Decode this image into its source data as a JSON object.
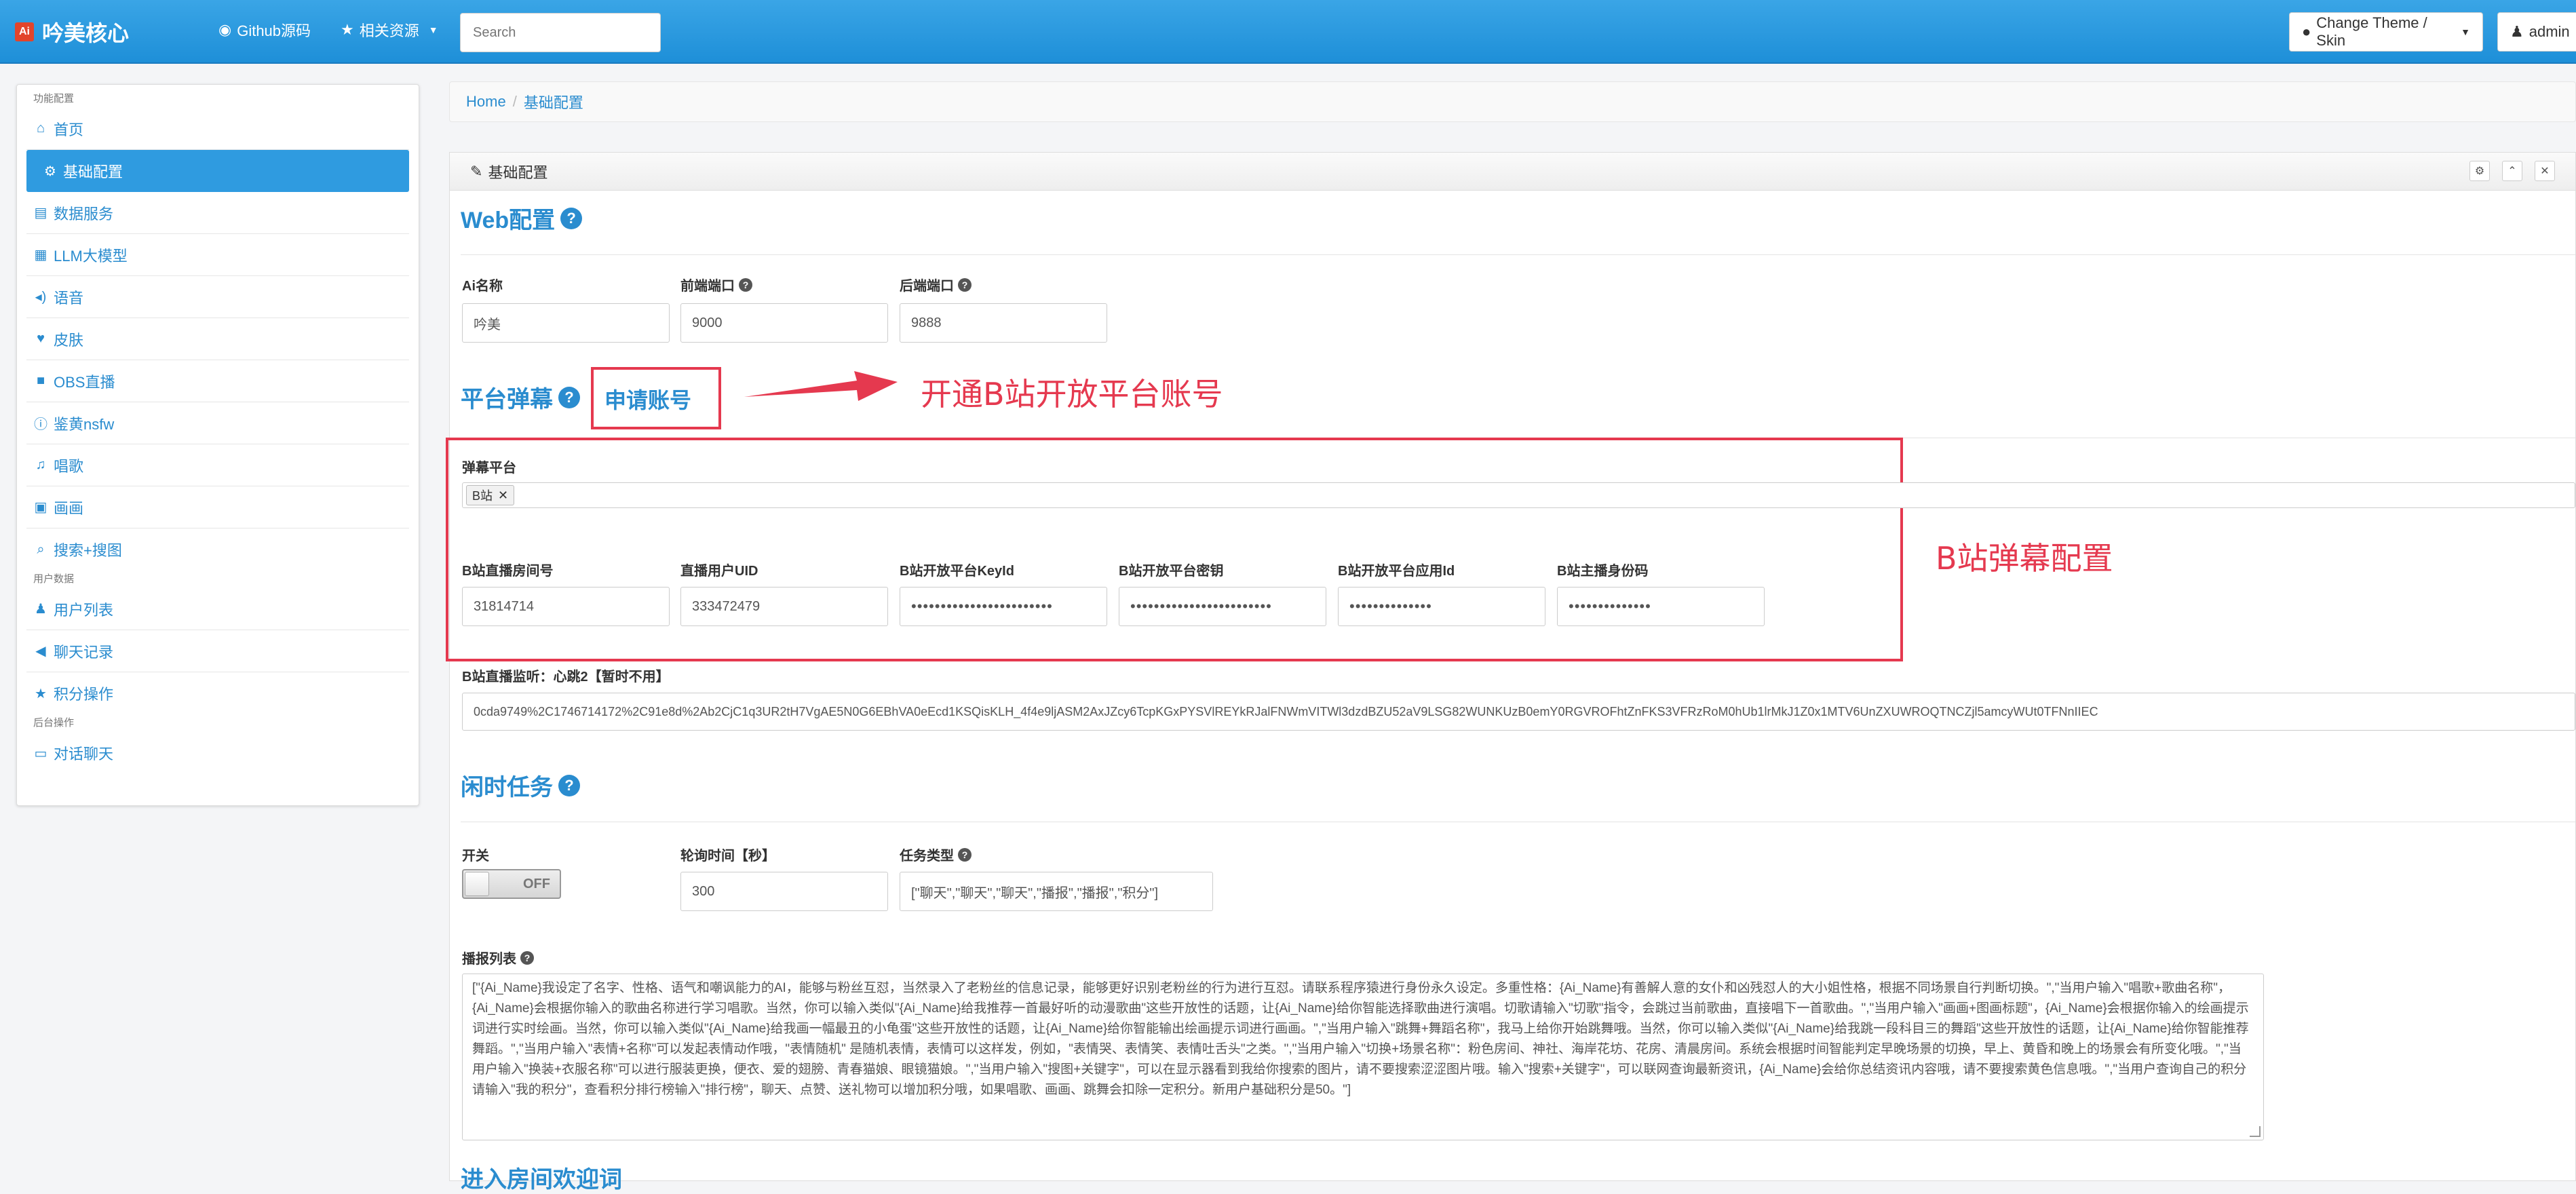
{
  "navbar": {
    "brand": "吟美核心",
    "brand_badge": "Ai",
    "github_link": "Github源码",
    "resources_link": "相关资源",
    "search_placeholder": "Search",
    "theme_button": "Change Theme / Skin",
    "user_button": "admin"
  },
  "sidebar": {
    "header_func": "功能配置",
    "header_user": "用户数据",
    "header_backend": "后台操作",
    "items_func": [
      {
        "icon": "home-icon",
        "label": "首页"
      },
      {
        "icon": "gear-icon",
        "label": "基础配置"
      },
      {
        "icon": "database-icon",
        "label": "数据服务"
      },
      {
        "icon": "grid-icon",
        "label": "LLM大模型"
      },
      {
        "icon": "volume-icon",
        "label": "语音"
      },
      {
        "icon": "heart-icon",
        "label": "皮肤"
      },
      {
        "icon": "video-icon",
        "label": "OBS直播"
      },
      {
        "icon": "info-icon",
        "label": "鉴黄nsfw"
      },
      {
        "icon": "music-icon",
        "label": "唱歌"
      },
      {
        "icon": "picture-icon",
        "label": "画画"
      },
      {
        "icon": "search-icon",
        "label": "搜索+搜图"
      }
    ],
    "items_user": [
      {
        "icon": "user-icon",
        "label": "用户列表"
      },
      {
        "icon": "bullhorn-icon",
        "label": "聊天记录"
      },
      {
        "icon": "star-icon",
        "label": "积分操作"
      }
    ],
    "items_backend": [
      {
        "icon": "comments-icon",
        "label": "对话聊天"
      }
    ]
  },
  "breadcrumb": {
    "home": "Home",
    "current": "基础配置"
  },
  "panel": {
    "title": "基础配置",
    "web": {
      "title": "Web配置",
      "ai_name_label": "Ai名称",
      "ai_name_value": "吟美",
      "front_port_label": "前端端口",
      "front_port_value": "9000",
      "back_port_label": "后端端口",
      "back_port_value": "9888"
    },
    "danmu": {
      "title": "平台弹幕",
      "apply_link": "申请账号",
      "annotation_open": "开通B站开放平台账号",
      "annotation_config": "B站弹幕配置",
      "platform_label": "弹幕平台",
      "platform_tag": "B站",
      "room_label": "B站直播房间号",
      "room_value": "31814714",
      "uid_label": "直播用户UID",
      "uid_value": "333472479",
      "keyid_label": "B站开放平台KeyId",
      "keyid_value": "••••••••••••••••••••••••",
      "secret_label": "B站开放平台密钥",
      "secret_value": "••••••••••••••••••••••••",
      "appid_label": "B站开放平台应用Id",
      "appid_value": "••••••••••••••",
      "anchor_label": "B站主播身份码",
      "anchor_value": "••••••••••••••",
      "monitor_label": "B站直播监听：心跳2【暂时不用】",
      "monitor_value": "0cda9749%2C1746714172%2C91e8d%2Ab2CjC1q3UR2tH7VgAE5N0G6EBhVA0eEcd1KSQisKLH_4f4e9ljASM2AxJZcy6TcpKGxPYSVlREYkRJalFNWmVITWl3dzdBZU52aV9LSG82WUNKUzB0emY0RGVROFhtZnFKS3VFRzRoM0hUb1lrMkJ1Z0x1MTV6UnZXUWROQTNCZjl5amcyWUt0TFNnIIEC"
    },
    "idle": {
      "title": "闲时任务",
      "switch_label": "开关",
      "switch_value": "OFF",
      "poll_label": "轮询时间【秒】",
      "poll_value": "300",
      "task_type_label": "任务类型",
      "task_type_value": "[\"聊天\",\"聊天\",\"聊天\",\"播报\",\"播报\",\"积分\"]",
      "broadcast_label": "播报列表",
      "broadcast_value": "[\"{Ai_Name}我设定了名字、性格、语气和嘲讽能力的AI，能够与粉丝互怼，当然录入了老粉丝的信息记录，能够更好识别老粉丝的行为进行互怼。请联系程序猿进行身份永久设定。多重性格：{Ai_Name}有善解人意的女仆和凶残怼人的大小姐性格，根据不同场景自行判断切换。\",\"当用户输入\"唱歌+歌曲名称\"，{Ai_Name}会根据你输入的歌曲名称进行学习唱歌。当然，你可以输入类似\"{Ai_Name}给我推荐一首最好听的动漫歌曲\"这些开放性的话题，让{Ai_Name}给你智能选择歌曲进行演唱。切歌请输入\"切歌\"指令，会跳过当前歌曲，直接唱下一首歌曲。\",\"当用户输入\"画画+图画标题\"，{Ai_Name}会根据你输入的绘画提示词进行实时绘画。当然，你可以输入类似\"{Ai_Name}给我画一幅最丑的小龟蛋\"这些开放性的话题，让{Ai_Name}给你智能输出绘画提示词进行画画。\",\"当用户输入\"跳舞+舞蹈名称\"，我马上给你开始跳舞哦。当然，你可以输入类似\"{Ai_Name}给我跳一段科目三的舞蹈\"这些开放性的话题，让{Ai_Name}给你智能推荐舞蹈。\",\"当用户输入\"表情+名称\"可以发起表情动作哦，\"表情随机\" 是随机表情，表情可以这样发，例如，\"表情哭、表情笑、表情吐舌头\"之类。\",\"当用户输入\"切换+场景名称\"：粉色房间、神社、海岸花坊、花房、清晨房间。系统会根据时间智能判定早晚场景的切换，早上、黄昏和晚上的场景会有所变化哦。\",\"当用户输入\"换装+衣服名称\"可以进行服装更换，便衣、爱的翅膀、青春猫娘、眼镜猫娘。\",\"当用户输入\"搜图+关键字\"，可以在显示器看到我给你搜索的图片，请不要搜索涩涩图片哦。输入\"搜索+关键字\"，可以联网查询最新资讯，{Ai_Name}会给你总结资讯内容哦，请不要搜索黄色信息哦。\",\"当用户查询自己的积分请输入\"我的积分\"，查看积分排行榜输入\"排行榜\"，聊天、点赞、送礼物可以增加积分哦，如果唱歌、画画、跳舞会扣除一定积分。新用户基础积分是50。\"]"
    },
    "welcome": {
      "title": "进入房间欢迎词"
    }
  },
  "colors": {
    "primary": "#2a8ccf",
    "navbar": "#2b9ae0",
    "annotation": "#e5394f"
  }
}
